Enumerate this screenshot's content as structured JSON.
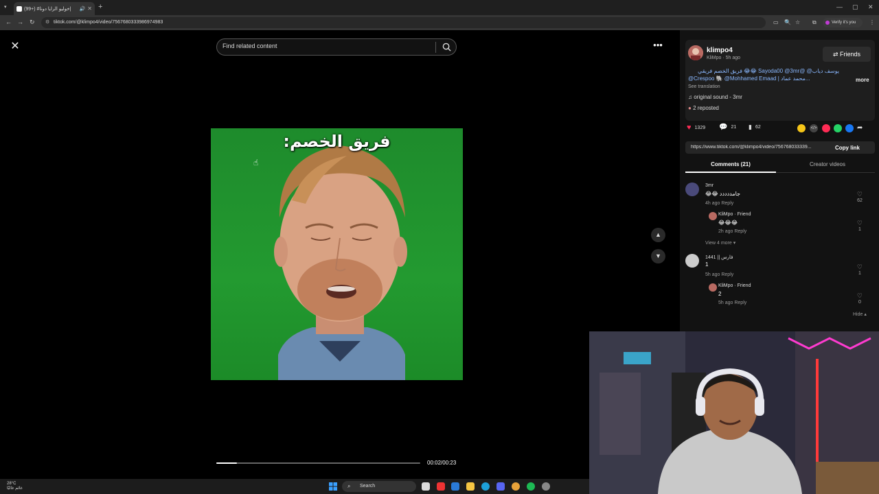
{
  "browser": {
    "tab_title": "(99+) #خوليو الرايا دونا|",
    "url": "tiktok.com/@klimpo4/video/7567680333986974983",
    "verify_label": "Verify it's you"
  },
  "search": {
    "placeholder": "Find related content"
  },
  "video": {
    "caption": "فريق الخصم:",
    "time": "00:02/00:23",
    "progress": 0.1
  },
  "post": {
    "author": "klimpo4",
    "author_sub": "KliMpo · 5h ago",
    "friends_label": "Friends",
    "description_line1": "يوسف دياب@ @Sayoda00 @3mr 😂😂 فريق الخصم فريقي",
    "description_line2": "@Crespoo 🐘 @Mohhamed Emaad | محمد عماد...",
    "more_label": "more",
    "translation_label": "See translation",
    "sound_label": "original sound - 3mr",
    "reposted_label": "2 reposted"
  },
  "actions": {
    "likes": "1329",
    "comments": "21",
    "saves": "62"
  },
  "link": {
    "url": "https://www.tiktok.com/@klimpo4/video/756768033339...",
    "copy_label": "Copy link"
  },
  "tabs": {
    "comments_label": "Comments (21)",
    "creator_label": "Creator videos"
  },
  "comments": [
    {
      "user": "3mr",
      "text": "😂😂 جامددددد",
      "meta": "4h ago   Reply",
      "likes": "62",
      "reply": {
        "user": "KliMpo · Friend",
        "text": "😂😂😂",
        "meta": "2h ago   Reply",
        "likes": "1"
      },
      "view_more": "View 4 more"
    },
    {
      "user": "1441 || فارس",
      "text": "1",
      "meta": "5h ago   Reply",
      "likes": "1",
      "reply": {
        "user": "KliMpo · Friend",
        "text": "2",
        "meta": "5h ago   Reply",
        "likes": "0"
      },
      "hide_label": "Hide"
    }
  ],
  "taskbar": {
    "temp": "28°C",
    "weather_text": "غائم غالبًا",
    "search_label": "Search"
  },
  "colors": {
    "green_screen": "#1e8b2c",
    "like_red": "#fe2c55",
    "link_blue": "#8ab8ff"
  }
}
